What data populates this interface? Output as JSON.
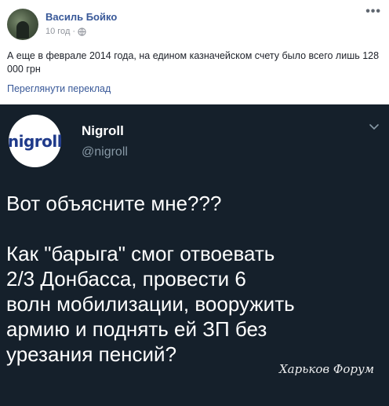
{
  "post": {
    "author": "Василь Бойко",
    "time": "10 год",
    "separator": "·",
    "more": "•••",
    "text": "А еще в феврале 2014 года, на едином казначейском счету было всего лишь 128 000 грн",
    "translate_link": "Переглянути переклад"
  },
  "tweet": {
    "avatar_text": "nigroll",
    "name": "Nigroll",
    "handle": "@nigroll",
    "lines_1": [
      "Вот объясните мне???"
    ],
    "lines_2": [
      "Как \"барыга\" смог отвоевать",
      "2/3 Донбасса, провести 6",
      "волн мобилизации, вооружить",
      "армию и поднять ей ЗП без",
      "урезания пенсий?"
    ]
  },
  "watermark": "Харьков Форум",
  "icons": {
    "globe": "globe-icon",
    "more": "more-options-icon",
    "chevron": "chevron-down-icon"
  }
}
